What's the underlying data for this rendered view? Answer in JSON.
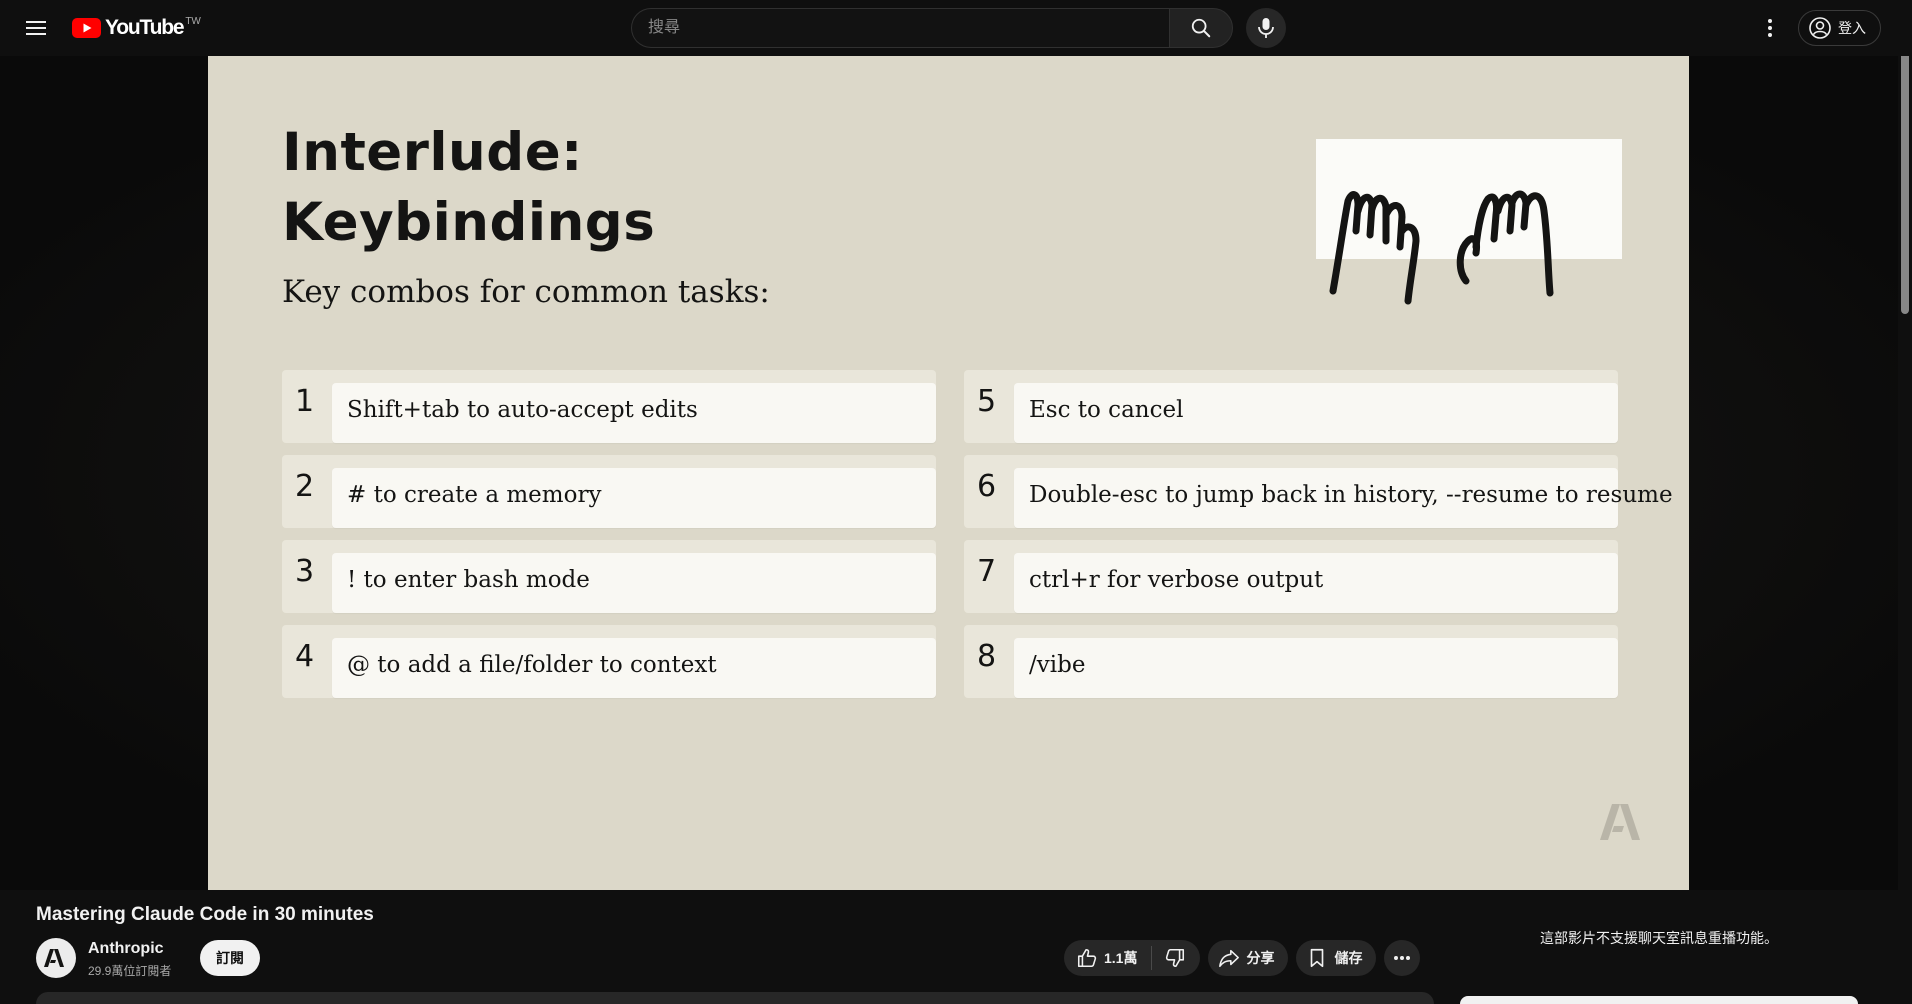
{
  "header": {
    "logo_text": "YouTube",
    "region": "TW",
    "search_placeholder": "搜尋",
    "signin_label": "登入"
  },
  "slide": {
    "title_line1": "Interlude:",
    "title_line2": "Keybindings",
    "subtitle": "Key combos for common tasks:",
    "keybindings": [
      {
        "num": "1",
        "text": "Shift+tab to auto-accept edits"
      },
      {
        "num": "5",
        "text": "Esc to cancel"
      },
      {
        "num": "2",
        "text": "# to create a memory"
      },
      {
        "num": "6",
        "text": "Double-esc to jump back in history, --resume to resume"
      },
      {
        "num": "3",
        "text": "! to enter bash mode"
      },
      {
        "num": "7",
        "text": "ctrl+r for verbose output"
      },
      {
        "num": "4",
        "text": "@ to add a file/folder to context"
      },
      {
        "num": "8",
        "text": "/vibe"
      }
    ]
  },
  "video": {
    "title": "Mastering Claude Code in 30 minutes",
    "channel_name": "Anthropic",
    "channel_subs": "29.9萬位訂閱者",
    "subscribe_label": "訂閱"
  },
  "actions": {
    "like_count": "1.1萬",
    "share_label": "分享",
    "save_label": "儲存"
  },
  "chat_note": "這部影片不支援聊天室訊息重播功能。",
  "colors": {
    "brand_red": "#ff0000",
    "slide_bg": "#dcd8c9",
    "page_bg": "#0f0f0f"
  }
}
